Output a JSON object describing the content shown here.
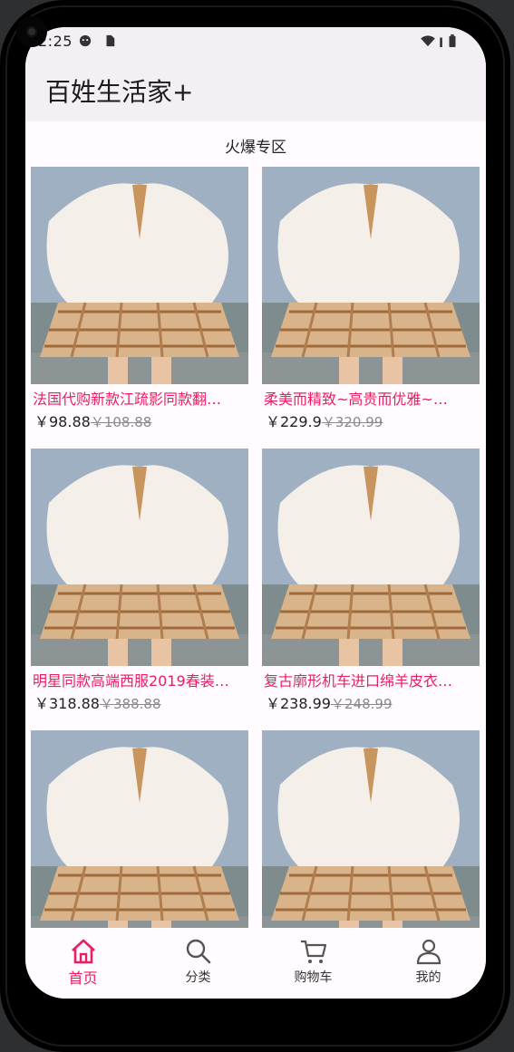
{
  "status": {
    "time": "2:25"
  },
  "app": {
    "title": "百姓生活家+"
  },
  "section": {
    "title": "火爆专区"
  },
  "products": [
    {
      "name": "法国代购新款江疏影同款翻…",
      "price": "￥98.88",
      "old_price": "￥108.88"
    },
    {
      "name": "柔美而精致~高贵而优雅~…",
      "price": "￥229.9",
      "old_price": "￥320.99"
    },
    {
      "name": "明星同款高端西服2019春装…",
      "price": "￥318.88",
      "old_price": "￥388.88"
    },
    {
      "name": "复古廓形机车进口绵羊皮衣…",
      "price": "￥238.99",
      "old_price": "￥248.99"
    },
    {
      "name": "",
      "price": "",
      "old_price": ""
    },
    {
      "name": "",
      "price": "",
      "old_price": ""
    }
  ],
  "nav": [
    {
      "label": "首页",
      "icon": "home-icon",
      "active": true
    },
    {
      "label": "分类",
      "icon": "search-icon",
      "active": false
    },
    {
      "label": "购物车",
      "icon": "cart-icon",
      "active": false
    },
    {
      "label": "我的",
      "icon": "person-icon",
      "active": false
    }
  ],
  "colors": {
    "accent": "#e91e63",
    "appbar": "#f3eff4",
    "background": "#fffbfe"
  }
}
